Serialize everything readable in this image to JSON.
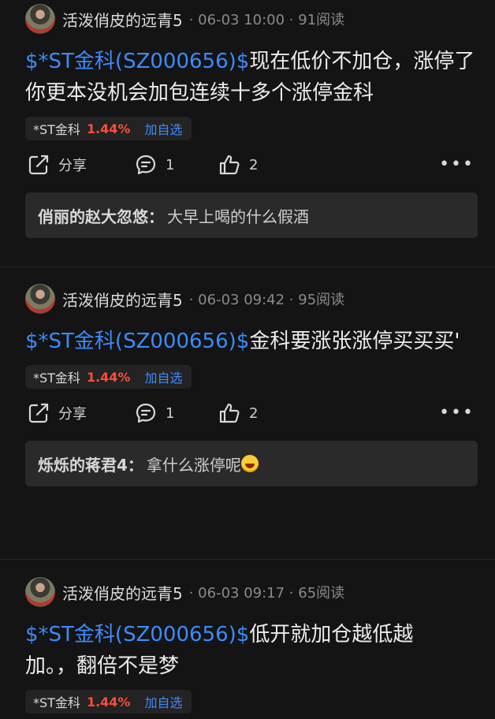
{
  "posts": [
    {
      "author": "活泼俏皮的远青5",
      "meta": "· 06-03 10:00 · 91阅读",
      "cashtag": "$*ST金科(SZ000656)$",
      "text": "现在低价不加仓，涨停了你更本没机会加包连续十多个涨停金科",
      "chip": {
        "name": "*ST金科",
        "pct": "1.44%",
        "add": "加自选"
      },
      "share_label": "分享",
      "comments": "1",
      "likes": "2",
      "reply": {
        "name": "俏丽的赵大忽悠：",
        "text": "大早上喝的什么假酒",
        "emoji": false
      }
    },
    {
      "author": "活泼俏皮的远青5",
      "meta": "· 06-03 09:42 · 95阅读",
      "cashtag": "$*ST金科(SZ000656)$",
      "text": "金科要涨张涨停买买买'",
      "chip": {
        "name": "*ST金科",
        "pct": "1.44%",
        "add": "加自选"
      },
      "share_label": "分享",
      "comments": "1",
      "likes": "2",
      "reply": {
        "name": "烁烁的蒋君4：",
        "text": "拿什么涨停呢",
        "emoji": true
      }
    },
    {
      "author": "活泼俏皮的远青5",
      "meta": "· 06-03 09:17 · 65阅读",
      "cashtag": "$*ST金科(SZ000656)$",
      "text": "低开就加仓越低越加。，翻倍不是梦",
      "chip": {
        "name": "*ST金科",
        "pct": "1.44%",
        "add": "加自选"
      }
    }
  ],
  "colors": {
    "background": "#141414",
    "link": "#3d8bfd",
    "rise": "#ff4d3a"
  }
}
